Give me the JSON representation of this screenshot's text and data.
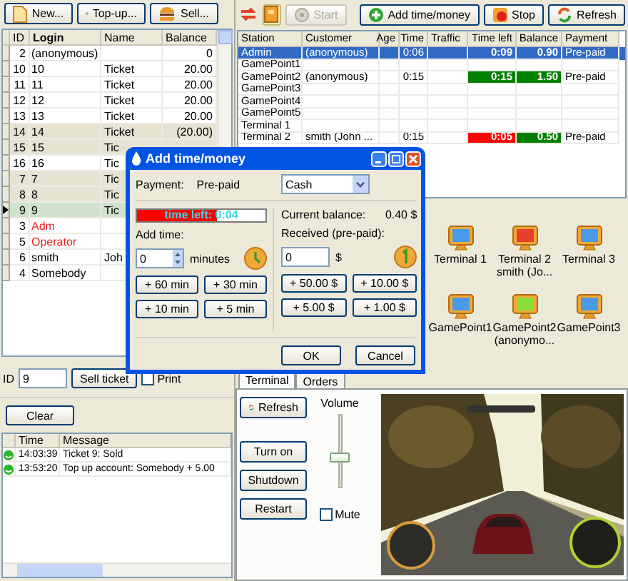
{
  "accounts_toolbar": [
    {
      "kind": "new",
      "label": "New..."
    },
    {
      "kind": "topup",
      "label": "Top-up..."
    },
    {
      "kind": "sell",
      "label": "Sell..."
    }
  ],
  "accounts": {
    "columns": [
      "ID",
      "Login",
      "Name",
      "Balance"
    ],
    "rows": [
      {
        "id": "2",
        "login": "(anonymous)",
        "balance": "0",
        "kind": "user",
        "shaded": false,
        "selected": false
      },
      {
        "id": "10",
        "login": "10",
        "name": "Ticket",
        "balance": "20.00",
        "kind": "user",
        "shaded": false,
        "selected": false
      },
      {
        "id": "11",
        "login": "11",
        "name": "Ticket",
        "balance": "20.00",
        "kind": "user",
        "shaded": false,
        "selected": false
      },
      {
        "id": "12",
        "login": "12",
        "name": "Ticket",
        "balance": "20.00",
        "kind": "user",
        "shaded": false,
        "selected": false
      },
      {
        "id": "13",
        "login": "13",
        "name": "Ticket",
        "balance": "20.00",
        "kind": "user",
        "shaded": false,
        "selected": false
      },
      {
        "id": "14",
        "login": "14",
        "name": "Ticket",
        "balance": "(20.00)",
        "kind": "user",
        "shaded": true,
        "selected": false
      },
      {
        "id": "15",
        "login": "15",
        "name": "Tic",
        "kind": "user",
        "shaded": true,
        "selected": false
      },
      {
        "id": "16",
        "login": "16",
        "name": "Tic",
        "kind": "user",
        "shaded": false,
        "selected": false
      },
      {
        "id": "7",
        "login": "7",
        "name": "Tic",
        "kind": "user",
        "shaded": true,
        "selected": false
      },
      {
        "id": "8",
        "login": "8",
        "name": "Tic",
        "kind": "user",
        "shaded": true,
        "selected": false
      },
      {
        "id": "9",
        "login": "9",
        "name": "Tic",
        "kind": "user",
        "shaded": false,
        "selected": true
      },
      {
        "id": "3",
        "login": "Adm",
        "kind": "staff",
        "shaded": false,
        "selected": false
      },
      {
        "id": "5",
        "login": "Operator",
        "kind": "staff",
        "shaded": false,
        "selected": false
      },
      {
        "id": "6",
        "login": "smith",
        "name": "Joh",
        "kind": "user",
        "shaded": false,
        "selected": false
      },
      {
        "id": "4",
        "login": "Somebody",
        "kind": "user",
        "shaded": false,
        "selected": false
      }
    ]
  },
  "ticket": {
    "id_label": "ID",
    "id_value": "9",
    "sell_button": "Sell ticket",
    "print": {
      "label": "Print",
      "checked": false
    },
    "clear_button": "Clear"
  },
  "log": {
    "columns": [
      "Time",
      "Message"
    ],
    "rows": [
      {
        "time": "14:03:39",
        "message": "Ticket 9: Sold"
      },
      {
        "time": "13:53:20",
        "message": "Top up account: Somebody + 5.00"
      }
    ]
  },
  "station_toolbar": [
    {
      "kind": "swap",
      "pressed": false
    },
    {
      "kind": "panel",
      "pressed": true
    },
    {
      "kind": "start",
      "label": "Start",
      "disabled": true
    },
    {
      "kind": "add",
      "label": "Add time/money",
      "disabled": false
    },
    {
      "kind": "stop",
      "label": "Stop",
      "disabled": false
    },
    {
      "kind": "refresh",
      "label": "Refresh",
      "disabled": false
    }
  ],
  "stations": {
    "columns": [
      "Station",
      "Customer",
      "Age",
      "Time",
      "Traffic",
      "Time left",
      "Balance",
      "Payment"
    ],
    "rows": [
      {
        "station": "Admin",
        "customer": "(anonymous)",
        "time": "0:06",
        "time_left": {
          "value": "0:09"
        },
        "balance": {
          "value": "0.90"
        },
        "payment": "Pre-paid",
        "selected": true
      },
      {
        "station": "GamePoint1",
        "selected": false
      },
      {
        "station": "GamePoint2",
        "customer": "(anonymous)",
        "time": "0:15",
        "time_left": {
          "value": "0:15",
          "color": "#008000"
        },
        "balance": {
          "value": "1.50",
          "color": "#008000"
        },
        "payment": "Pre-paid",
        "selected": false
      },
      {
        "station": "GamePoint3",
        "selected": false
      },
      {
        "station": "GamePoint4",
        "selected": false
      },
      {
        "station": "GamePoint5",
        "selected": false
      },
      {
        "station": "Terminal 1",
        "selected": false
      },
      {
        "station": "Terminal 2",
        "customer": "smith (John ...",
        "time": "0:15",
        "time_left": {
          "value": "0:05",
          "color": "#ff0000"
        },
        "balance": {
          "value": "0.50",
          "color": "#008000"
        },
        "payment": "Pre-paid",
        "selected": false
      }
    ]
  },
  "station_icons": [
    {
      "name": "Terminal 1",
      "color": "#4a9ae8"
    },
    {
      "name": "Terminal 2",
      "customer": "smith (Jo...",
      "color": "#e8402a"
    },
    {
      "name": "Terminal 3",
      "color": "#4a9ae8"
    },
    {
      "name": "GamePoint1",
      "color": "#4a9ae8"
    },
    {
      "name": "GamePoint2",
      "customer": "(anonymo...",
      "color": "#8ede3a"
    },
    {
      "name": "GamePoint3",
      "color": "#4a9ae8"
    }
  ],
  "terminal": {
    "tabs": [
      {
        "label": "Terminal",
        "selected": true
      },
      {
        "label": "Orders",
        "selected": false
      }
    ],
    "refresh_button": "Refresh",
    "buttons": [
      "Turn on",
      "Shutdown",
      "Restart"
    ],
    "volume": {
      "label": "Volume",
      "level": 0.4
    },
    "mute": {
      "label": "Mute",
      "checked": false
    },
    "screen": {
      "kind": "picture"
    }
  },
  "dialog": {
    "title": "Add time/money",
    "payment_label": "Payment:",
    "payment_value": "Pre-paid",
    "method": "Cash",
    "time_left": {
      "text": "time left: 0:04",
      "level": 0.62
    },
    "add_time_label": "Add time:",
    "minutes_value": "0",
    "minutes_unit": "minutes",
    "time_buttons": [
      "+ 60 min",
      "+ 30 min",
      "+ 10 min",
      "+ 5 min"
    ],
    "balance_label": "Current balance:",
    "balance_value": "0.40 $",
    "received_label": "Received (pre-paid):",
    "received_value": "0",
    "currency": "$",
    "money_buttons": [
      "+ 50.00 $",
      "+ 10.00 $",
      "+ 5.00 $",
      "+ 1.00 $"
    ],
    "ok": "OK",
    "cancel": "Cancel"
  }
}
